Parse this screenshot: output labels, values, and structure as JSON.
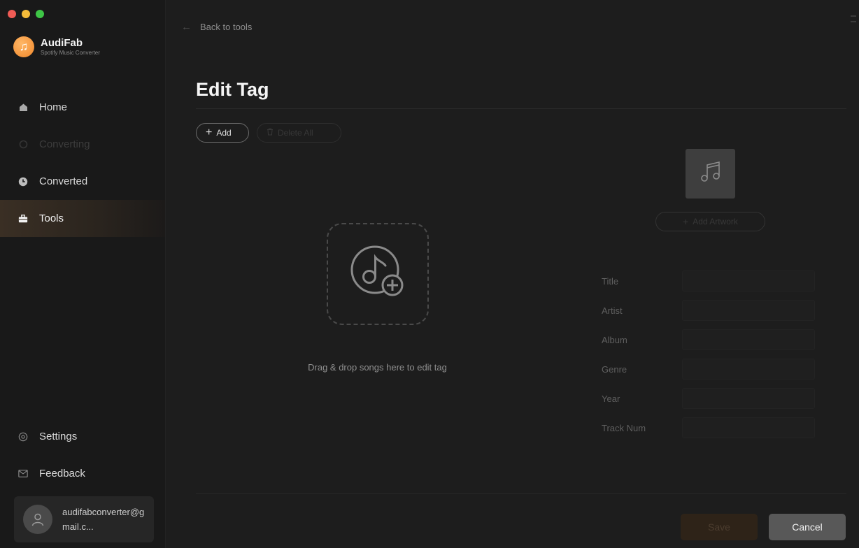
{
  "app": {
    "name": "AudiFab",
    "subtitle": "Spotify Music Converter",
    "logo_glyph": "♫"
  },
  "colors": {
    "accent": "#f0872a",
    "sidebar_bg": "#191919",
    "main_bg": "#1d1d1d",
    "active_item_bg": "#3a2f24"
  },
  "sidebar": {
    "items": [
      {
        "label": "Home",
        "icon": "home-icon",
        "state": "normal"
      },
      {
        "label": "Converting",
        "icon": "converting-icon",
        "state": "disabled"
      },
      {
        "label": "Converted",
        "icon": "clock-icon",
        "state": "normal"
      },
      {
        "label": "Tools",
        "icon": "toolbox-icon",
        "state": "active"
      }
    ],
    "bottom_items": [
      {
        "label": "Settings",
        "icon": "gear-icon"
      },
      {
        "label": "Feedback",
        "icon": "mail-icon"
      }
    ],
    "user": {
      "email": "audifabconverter@gmail.c..."
    }
  },
  "main": {
    "back_label": "Back to tools",
    "title": "Edit Tag",
    "toolbar": {
      "add_label": "Add",
      "delete_all_label": "Delete All"
    },
    "dropzone_text": "Drag & drop songs here to edit tag",
    "add_artwork_label": "Add Artwork",
    "tags": [
      {
        "label": "Title",
        "value": ""
      },
      {
        "label": "Artist",
        "value": ""
      },
      {
        "label": "Album",
        "value": ""
      },
      {
        "label": "Genre",
        "value": ""
      },
      {
        "label": "Year",
        "value": ""
      },
      {
        "label": "Track Num",
        "value": ""
      }
    ],
    "save_label": "Save",
    "cancel_label": "Cancel"
  }
}
